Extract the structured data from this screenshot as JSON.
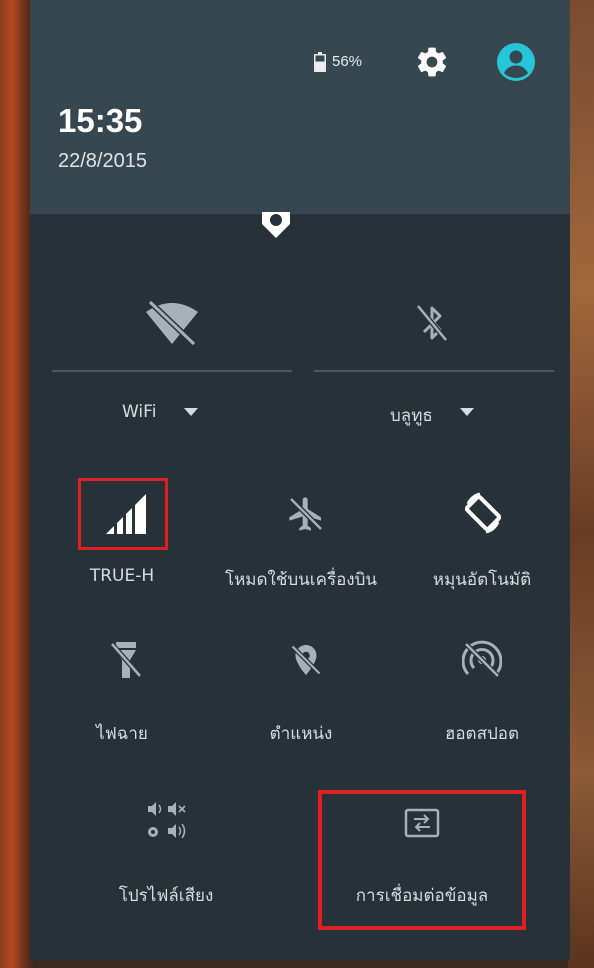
{
  "status": {
    "time": "15:35",
    "date": "22/8/2015",
    "battery_text": "56%"
  },
  "connectivity": {
    "wifi_label": "WiFi",
    "bluetooth_label": "บลูทูธ"
  },
  "tiles": [
    {
      "label": "TRUE-H",
      "icon": "signal-icon"
    },
    {
      "label": "โหมดใช้บนเครื่องบิน",
      "icon": "airplane-icon"
    },
    {
      "label": "หมุนอัตโนมัติ",
      "icon": "auto-rotate-icon"
    },
    {
      "label": "ไฟฉาย",
      "icon": "flashlight-off-icon"
    },
    {
      "label": "ตำแหน่ง",
      "icon": "location-off-icon"
    },
    {
      "label": "ฮอตสปอต",
      "icon": "hotspot-off-icon"
    },
    {
      "label": "โปรไฟล์เสียง",
      "icon": "sound-profile-icon"
    },
    {
      "label": "การเชื่อมต่อข้อมูล",
      "icon": "data-connection-icon"
    }
  ],
  "colors": {
    "header_bg": "#37474f",
    "panel_bg": "#263238",
    "accent": "#26c6da",
    "highlight": "#e02020"
  }
}
